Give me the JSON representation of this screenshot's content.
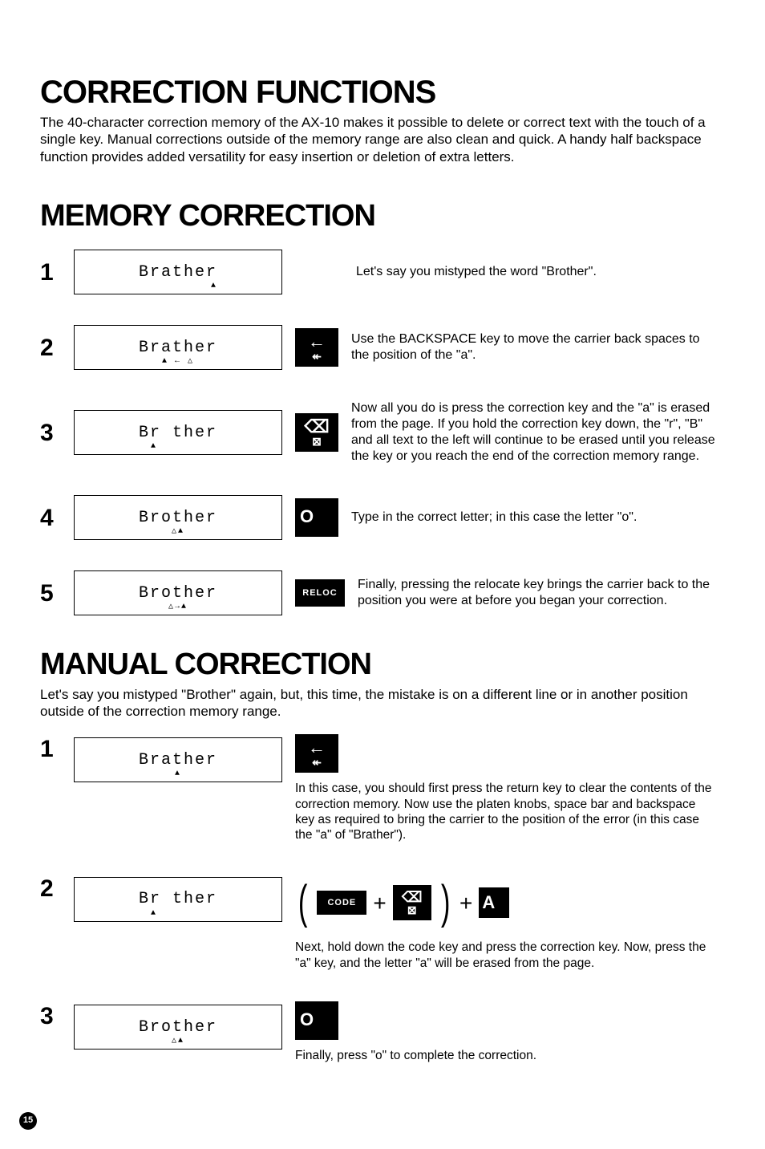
{
  "title_main": "CORRECTION FUNCTIONS",
  "intro": "The 40-character correction memory of the AX-10 makes it possible to delete or correct text with the touch of a single key. Manual corrections outside of the memory range are also clean and quick. A handy half backspace function provides added versatility for easy insertion or deletion of extra letters.",
  "title_mem": "MEMORY CORRECTION",
  "mem_steps": [
    {
      "num": "1",
      "display": "Brather",
      "indicator": "▲",
      "key_content": "",
      "desc": "Let's say you mistyped the word \"Brother\"."
    },
    {
      "num": "2",
      "display": "Brather",
      "indicator": "▲ ← △",
      "key_top": "←",
      "key_bot": "↞",
      "desc": "Use the BACKSPACE key to move the carrier back spaces to the position of the \"a\"."
    },
    {
      "num": "3",
      "display": "Br ther",
      "indicator": "▲",
      "key_top": "⌫",
      "key_bot": "⊠",
      "desc": "Now all you do is press the correction key and the \"a\" is erased from the page. If you hold the correction key down, the \"r\", \"B\" and all text to the left will continue to be erased until you release the key or you reach the end of the correction memory range."
    },
    {
      "num": "4",
      "display": "Brother",
      "indicator": "△▲",
      "key_content": "O",
      "desc": "Type in the correct letter; in this case the letter \"o\"."
    },
    {
      "num": "5",
      "display": "Brother",
      "indicator": "△→▲",
      "key_content": "RELOC",
      "desc": "Finally, pressing the relocate key brings the carrier back to the position you were at before you began your correction."
    }
  ],
  "title_man": "MANUAL CORRECTION",
  "man_intro": "Let's say you mistyped \"Brother\" again, but, this time, the mistake is on a different line or in another position outside of the correction memory range.",
  "man_steps": [
    {
      "num": "1",
      "display": "Brather",
      "indicator": "▲",
      "key_top": "←",
      "key_bot": "↞",
      "desc": "In this case, you should first press the return key to clear the contents of the correction memory. Now use the platen knobs, space bar and backspace key as required to bring the carrier to the position of the error (in this case the \"a\" of \"Brather\")."
    },
    {
      "num": "2",
      "display": "Br ther",
      "indicator": "▲",
      "code_label": "CODE",
      "plus1": "+",
      "corr_top": "⌫",
      "corr_bot": "⊠",
      "plus2": "+",
      "letter": "A",
      "desc": "Next, hold down the code key and press the correction key. Now, press the \"a\" key, and the letter \"a\" will be erased from the page."
    },
    {
      "num": "3",
      "display": "Brother",
      "indicator": "△▲",
      "key_content": "O",
      "desc": "Finally, press \"o\" to complete the correction."
    }
  ],
  "page_number": "15"
}
